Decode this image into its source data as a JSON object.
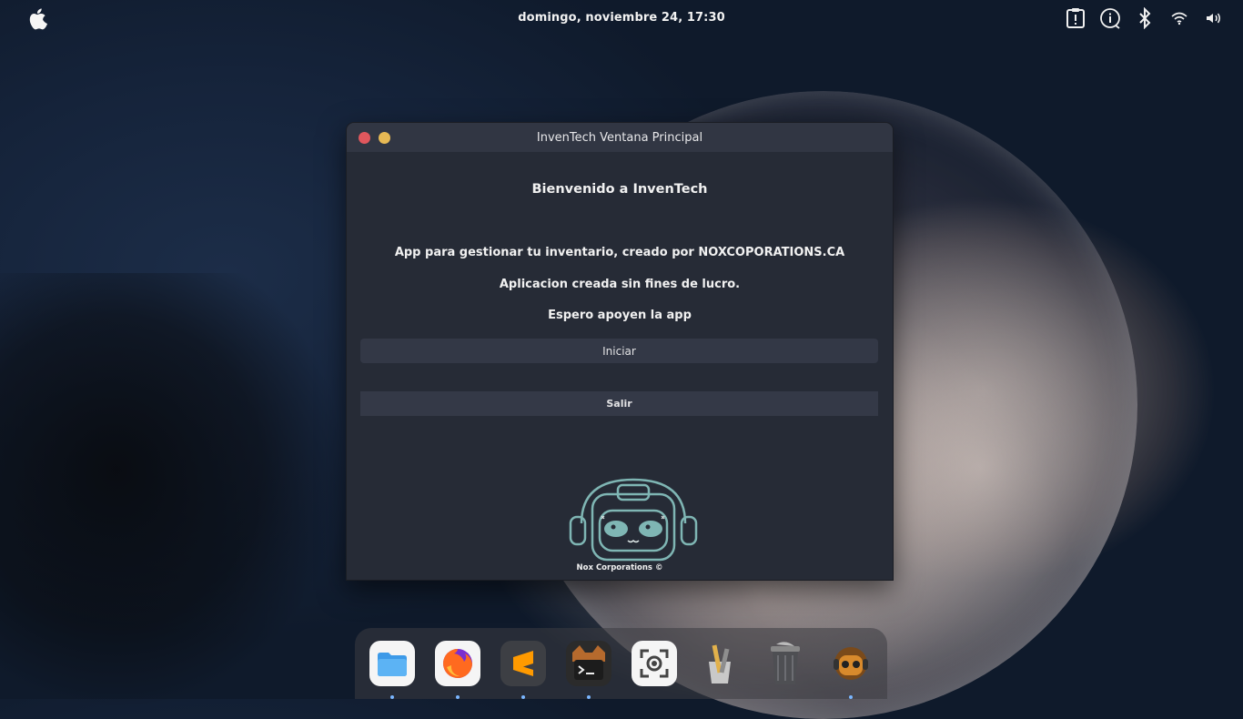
{
  "topbar": {
    "clock": "domingo, noviembre 24, 17:30",
    "icons": [
      "apple-logo-icon",
      "clipboard-icon",
      "info-icon",
      "bluetooth-icon",
      "wifi-icon",
      "volume-icon"
    ]
  },
  "window": {
    "title": "InvenTech Ventana Principal",
    "welcome": "Bienvenido a InvenTech",
    "description": "App para gestionar tu inventario, creado por NOXCOPORATIONS.CA",
    "nonprofit": "Aplicacion creada sin fines de lucro.",
    "support": "Espero apoyen la app",
    "start_button": "Iniciar",
    "exit_button": "Salir",
    "footer": "Nox Corporations ©"
  },
  "dock": {
    "apps": [
      "files-icon",
      "firefox-icon",
      "sublime-text-icon",
      "terminal-icon",
      "screenshot-icon",
      "text-editor-icon",
      "trash-icon",
      "inventech-icon"
    ]
  },
  "colors": {
    "window_bg": "#262b36",
    "titlebar_bg": "#313643",
    "button_bg": "#333846",
    "close": "#e0575d",
    "minimize": "#e7b954",
    "mascot": "#7fb6b4"
  }
}
